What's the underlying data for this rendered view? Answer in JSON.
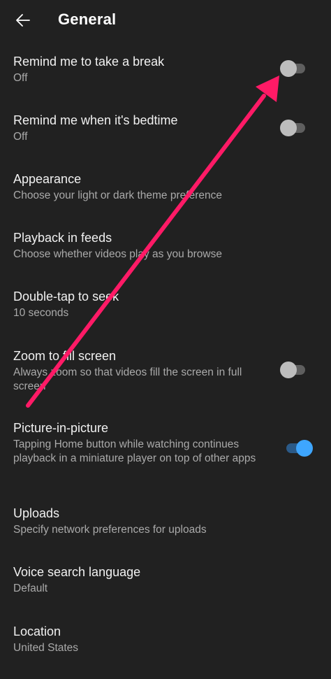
{
  "header": {
    "title": "General",
    "back_icon": "arrow-left-icon"
  },
  "settings": [
    {
      "label": "Remind me to take a break",
      "sub": "Off",
      "toggle": false
    },
    {
      "label": "Remind me when it's bedtime",
      "sub": "Off",
      "toggle": false
    },
    {
      "label": "Appearance",
      "sub": "Choose your light or dark theme preference"
    },
    {
      "label": "Playback in feeds",
      "sub": "Choose whether videos play as you browse"
    },
    {
      "label": "Double-tap to seek",
      "sub": "10 seconds"
    },
    {
      "label": "Zoom to fill screen",
      "sub": "Always zoom so that videos fill the screen in full screen",
      "toggle": false
    },
    {
      "label": "Picture-in-picture",
      "sub": "Tapping Home button while watching continues playback in a miniature player on top of other apps",
      "toggle": true
    },
    {
      "label": "Uploads",
      "sub": "Specify network preferences for uploads"
    },
    {
      "label": "Voice search language",
      "sub": "Default"
    },
    {
      "label": "Location",
      "sub": "United States"
    }
  ],
  "colors": {
    "background": "#212121",
    "toggle_on": "#3ea6ff",
    "annotation_arrow": "#ff1a66"
  }
}
